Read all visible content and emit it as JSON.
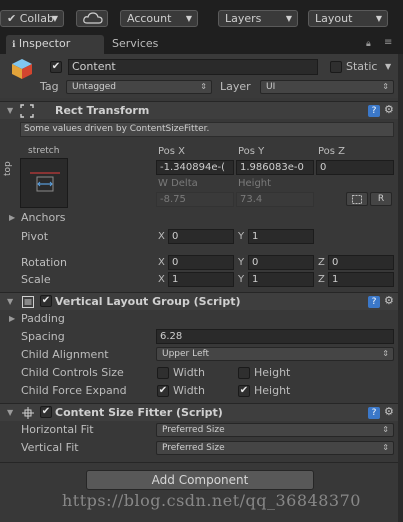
{
  "toolbar": {
    "collab_label": "Collab",
    "cloud_icon": "cloud-icon",
    "account_label": "Account",
    "layers_label": "Layers",
    "layout_label": "Layout"
  },
  "tabs": {
    "inspector": "Inspector",
    "services": "Services"
  },
  "object": {
    "name": "Content",
    "static_label": "Static",
    "tag_label": "Tag",
    "tag_value": "Untagged",
    "layer_label": "Layer",
    "layer_value": "UI"
  },
  "rect_transform": {
    "title": "Rect Transform",
    "notice": "Some values driven by ContentSizeFitter.",
    "anchor_preset_top": "stretch",
    "anchor_preset_side": "top",
    "pos_x_label": "Pos X",
    "pos_y_label": "Pos Y",
    "pos_z_label": "Pos Z",
    "pos_x_value": "-1.340894e-(",
    "pos_y_value": "1.986083e-0",
    "pos_z_value": "0",
    "w_delta_label": "W Delta",
    "height_label": "Height",
    "w_delta_value": "-8.75",
    "height_value": "73.4",
    "r_button": "R",
    "anchors_label": "Anchors",
    "pivot_label": "Pivot",
    "pivot_x": "0",
    "pivot_y": "1",
    "rotation_label": "Rotation",
    "rotation_x": "0",
    "rotation_y": "0",
    "rotation_z": "0",
    "scale_label": "Scale",
    "scale_x": "1",
    "scale_y": "1",
    "scale_z": "1",
    "axis_x": "X",
    "axis_y": "Y",
    "axis_z": "Z"
  },
  "vertical_layout": {
    "title": "Vertical Layout Group (Script)",
    "padding_label": "Padding",
    "spacing_label": "Spacing",
    "spacing_value": "6.28",
    "child_alignment_label": "Child Alignment",
    "child_alignment_value": "Upper Left",
    "child_controls_label": "Child Controls Size",
    "child_force_label": "Child Force Expand",
    "width_label": "Width",
    "height_label": "Height"
  },
  "content_size_fitter": {
    "title": "Content Size Fitter (Script)",
    "horizontal_label": "Horizontal Fit",
    "horizontal_value": "Preferred Size",
    "vertical_label": "Vertical Fit",
    "vertical_value": "Preferred Size"
  },
  "add_component_label": "Add Component",
  "watermark": "https://blog.csdn.net/qq_36848370"
}
